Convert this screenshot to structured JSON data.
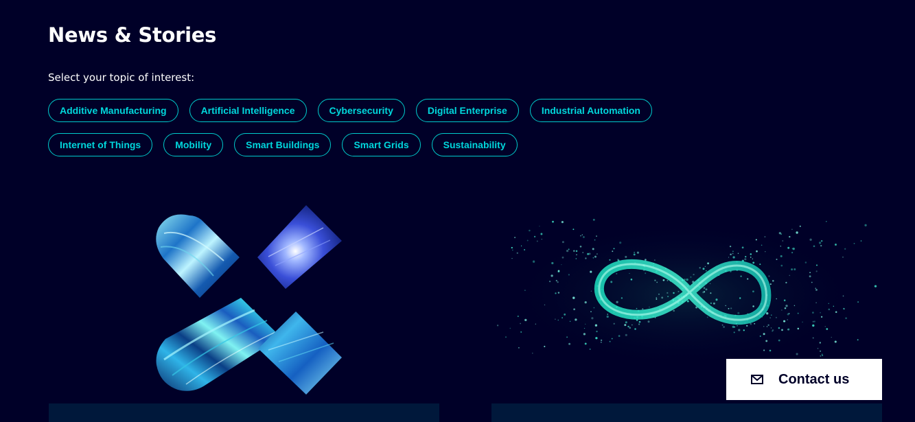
{
  "section": {
    "title": "News & Stories",
    "topic_prompt": "Select your topic of interest:"
  },
  "topics": {
    "row1": [
      "Additive Manufacturing",
      "Artificial Intelligence",
      "Cybersecurity",
      "Digital Enterprise",
      "Industrial Automation"
    ],
    "row2": [
      "Internet of Things",
      "Mobility",
      "Smart Buildings",
      "Smart Grids",
      "Sustainability"
    ]
  },
  "cards": [
    {
      "image_icon": "x-mark-image"
    },
    {
      "image_icon": "infinity-particle-image"
    }
  ],
  "contact": {
    "label": "Contact us",
    "icon": "mail-icon"
  },
  "colors": {
    "background": "#000028",
    "accent": "#00d7dc",
    "card_footer": "#00183b",
    "contact_bg": "#ffffff"
  }
}
